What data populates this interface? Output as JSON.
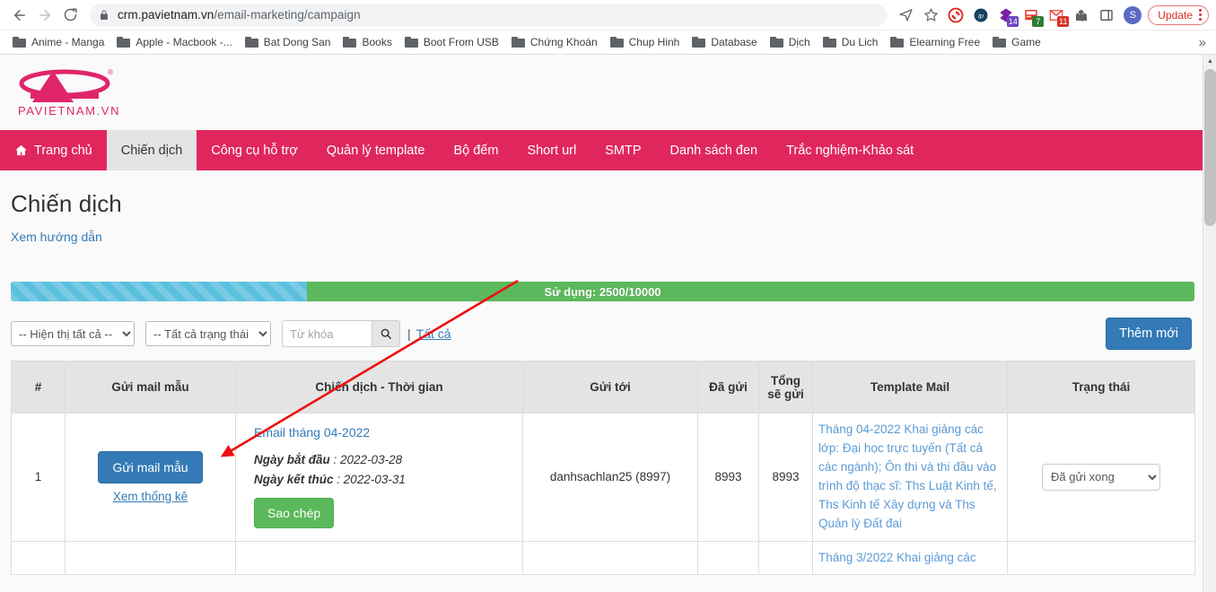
{
  "browser": {
    "back_icon": "back-arrow-icon",
    "forward_icon": "forward-arrow-icon",
    "reload_icon": "reload-icon",
    "lock_icon": "lock-icon",
    "url_domain": "crm.pavietnam.vn",
    "url_path": "/email-marketing/campaign",
    "url_full": "crm.pavietnam.vn/email-marketing/campaign",
    "share_icon": "send-share-icon",
    "bookmark_icon": "star-bookmark-icon",
    "extensions": [
      {
        "name": "adblock-icon",
        "badge": "",
        "badge_color": ""
      },
      {
        "name": "ip-extension-icon",
        "badge": "",
        "badge_color": ""
      },
      {
        "name": "evernote-icon",
        "badge": "14",
        "badge_color": "#6f42c1"
      },
      {
        "name": "notes-extension-icon",
        "badge": "7",
        "badge_color": ""
      },
      {
        "name": "gmail-icon",
        "badge": "11",
        "badge_color": "#d93025"
      },
      {
        "name": "puzzle-extensions-icon",
        "badge": "",
        "badge_color": ""
      },
      {
        "name": "sidepanel-icon",
        "badge": "",
        "badge_color": ""
      }
    ],
    "profile_initial": "S",
    "update_label": "Update",
    "menu_icon": "kebab-menu-icon",
    "bookmarks": [
      "Anime - Manga",
      "Apple - Macbook -...",
      "Bat Dong San",
      "Books",
      "Boot From USB",
      "Chứng Khoán",
      "Chup Hinh",
      "Database",
      "Dịch",
      "Du Lich",
      "Elearning Free",
      "Game"
    ],
    "bookmarks_overflow": "»"
  },
  "site": {
    "logo_text": "PAVIETNAM.VN",
    "logo_trademark": "®",
    "nav": [
      {
        "label": "Trang chủ",
        "icon": "home-icon",
        "active": false
      },
      {
        "label": "Chiến dịch",
        "icon": "",
        "active": true
      },
      {
        "label": "Công cụ hỗ trợ",
        "icon": "",
        "active": false
      },
      {
        "label": "Quản lý template",
        "icon": "",
        "active": false
      },
      {
        "label": "Bộ đếm",
        "icon": "",
        "active": false
      },
      {
        "label": "Short url",
        "icon": "",
        "active": false
      },
      {
        "label": "SMTP",
        "icon": "",
        "active": false
      },
      {
        "label": "Danh sách đen",
        "icon": "",
        "active": false
      },
      {
        "label": "Trắc nghiệm-Khảo sát",
        "icon": "",
        "active": false
      }
    ],
    "nav_bg": "#e0275d"
  },
  "main": {
    "title": "Chiến dịch",
    "guide_link": "Xem hướng dẫn",
    "usage": {
      "text": "Sử dụng: 2500/10000",
      "used": 2500,
      "total": 10000,
      "percent": 25,
      "fill_color": "#5bc0de",
      "track_color": "#5cb85c"
    },
    "filters": {
      "display_select": "-- Hiện thị tất cả --",
      "status_select": "-- Tất cả trạng thái --",
      "search_placeholder": "Từ khóa",
      "search_value": "",
      "search_icon": "search-icon",
      "separator": "|",
      "all_link": "Tất cả",
      "add_button": "Thêm mới"
    },
    "table": {
      "headers": [
        "#",
        "Gửi mail mẫu",
        "Chiến dịch - Thời gian",
        "Gửi tới",
        "Đã gửi",
        "Tổng sẽ gửi",
        "Template Mail",
        "Trạng thái"
      ],
      "rows": [
        {
          "index": "1",
          "send_sample_button": "Gửi mail mẫu",
          "stats_link": "Xem thống kê",
          "campaign_name": "Email tháng 04-2022",
          "start_label": "Ngày bắt đầu",
          "start_value": ": 2022-03-28",
          "end_label": "Ngày kết thúc",
          "end_value": ": 2022-03-31",
          "copy_button": "Sao chép",
          "send_to": "danhsachlan25 (8997)",
          "sent": "8993",
          "total_to_send": "8993",
          "template": "Tháng 04-2022 Khai giảng các lớp: Đại học trực tuyến (Tất cả các ngành); Ôn thi và thi đầu vào trình độ thạc sĩ: Ths Luật Kinh tế, Ths Kinh tế Xây dựng và Ths Quản lý Đất đai",
          "status": "Đã gửi xong"
        },
        {
          "index": "",
          "send_sample_button": "",
          "stats_link": "",
          "campaign_name": "",
          "start_label": "",
          "start_value": "",
          "end_label": "",
          "end_value": "",
          "copy_button": "",
          "send_to": "",
          "sent": "",
          "total_to_send": "",
          "template": "Tháng 3/2022 Khai giảng các",
          "status": ""
        }
      ]
    }
  },
  "annotation": {
    "arrow_color": "#ee1111",
    "description": "red-arrow-pointing-to-send-sample-button"
  }
}
